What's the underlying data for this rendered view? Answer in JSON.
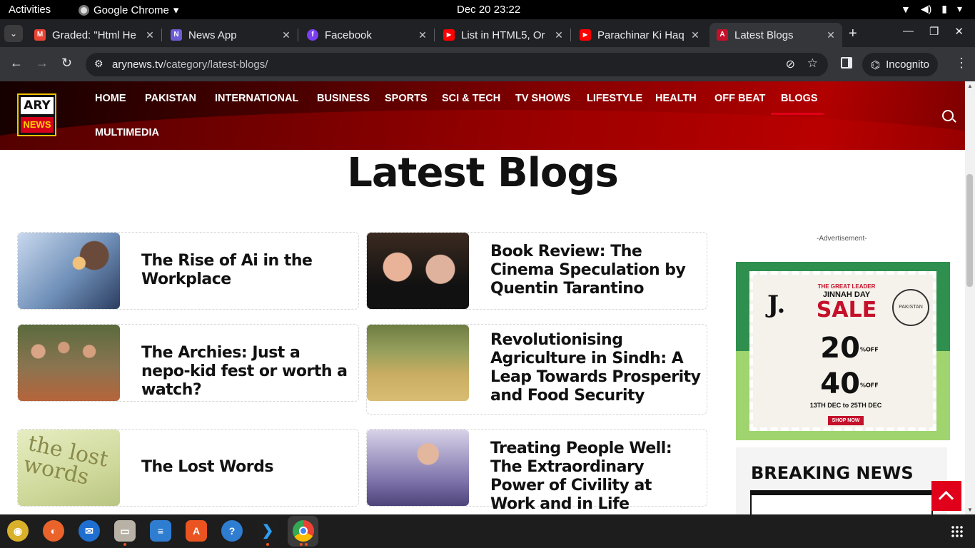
{
  "os_bar": {
    "activities": "Activities",
    "app_name": "Google Chrome",
    "clock": "Dec 20  23:22"
  },
  "tabs": [
    {
      "title": "Graded: \"Html He",
      "icon": "gmail-icon",
      "color": "#ea4335",
      "glyph": "M"
    },
    {
      "title": "News App",
      "icon": "news-app-icon",
      "color": "#6b5cd6",
      "glyph": "N"
    },
    {
      "title": "Facebook",
      "icon": "facebook-icon",
      "color": "#7b3ff2",
      "glyph": "f"
    },
    {
      "title": "List in HTML5, Or",
      "icon": "youtube-icon",
      "color": "#ff0000",
      "glyph": "▶"
    },
    {
      "title": "Parachinar Ki Haq",
      "icon": "youtube-icon",
      "color": "#ff0000",
      "glyph": "▶"
    },
    {
      "title": "Latest Blogs",
      "icon": "ary-news-icon",
      "color": "#c4102a",
      "glyph": "A"
    }
  ],
  "toolbar": {
    "url_domain": "arynews.tv",
    "url_path": "/category/latest-blogs/",
    "incognito_label": "Incognito"
  },
  "site": {
    "logo_top": "ARY",
    "logo_bottom": "NEWS",
    "nav": [
      "HOME",
      "PAKISTAN",
      "INTERNATIONAL",
      "BUSINESS",
      "SPORTS",
      "SCI & TECH",
      "TV SHOWS",
      "LIFESTYLE",
      "HEALTH",
      "OFF BEAT",
      "BLOGS",
      "MULTIMEDIA"
    ],
    "active_nav": "BLOGS"
  },
  "page": {
    "title": "Latest Blogs",
    "posts": [
      {
        "title": "The Rise of Ai in the Workplace",
        "thumb": "ai-workplace"
      },
      {
        "title": "Book Review: The Cinema Speculation by Quentin Tarantino",
        "thumb": "tarantino"
      },
      {
        "title": "The Archies: Just a nepo-kid fest or worth a watch?",
        "thumb": "archies"
      },
      {
        "title": "Revolutionising Agriculture in Sindh: A Leap Towards Prosperity and Food Security",
        "thumb": "agriculture"
      },
      {
        "title": "The Lost Words",
        "thumb": "lost-words"
      },
      {
        "title": "Treating People Well: The Extraordinary Power of Civility at Work and in Life",
        "thumb": "civility"
      }
    ],
    "lost_words_cover": "the lost words"
  },
  "sidebar": {
    "ad_label": "-Advertisement-",
    "ad": {
      "brand": "J.",
      "headline": "THE GREAT LEADER",
      "subhead": "JINNAH DAY",
      "sale": "SALE",
      "seal": "PAKISTAN",
      "offer1": "20",
      "offer2": "40",
      "offer_suffix": "%OFF",
      "dates": "13TH DEC to 25TH DEC",
      "cta": "SHOP NOW"
    },
    "breaking_title": "BREAKING NEWS"
  },
  "dock": [
    "rhythmbox",
    "firefox",
    "thunderbird",
    "files",
    "libreoffice-writer",
    "app-center",
    "help",
    "vscode",
    "chrome"
  ]
}
